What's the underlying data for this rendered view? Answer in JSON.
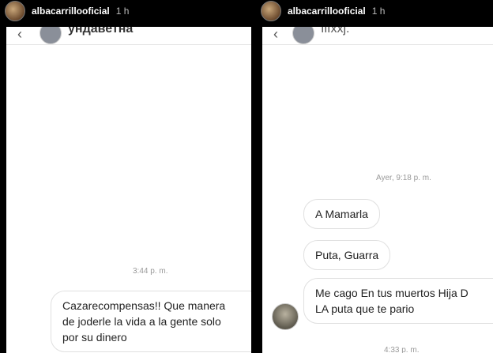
{
  "left": {
    "story_user": "albacarrillooficial",
    "story_time": "1 h",
    "chat_contact": "ундаветна",
    "timestamp": "3:44 p. m.",
    "message_lines": [
      "Cazarecompensas!! Que manera",
      "de joderle la vida a la gente solo",
      "por su dinero"
    ]
  },
  "right": {
    "story_user": "albacarrillooficial",
    "story_time": "1 h",
    "chat_contact": "ılıxxj.",
    "timestamp_top": "Ayer, 9:18 p. m.",
    "messages": [
      "A Mamarla",
      "Puta, Guarra"
    ],
    "last_message_lines": [
      "Me cago En tus muertos Hija D",
      "LA puta que te pario"
    ],
    "timestamp_bottom": "4:33 p. m."
  }
}
